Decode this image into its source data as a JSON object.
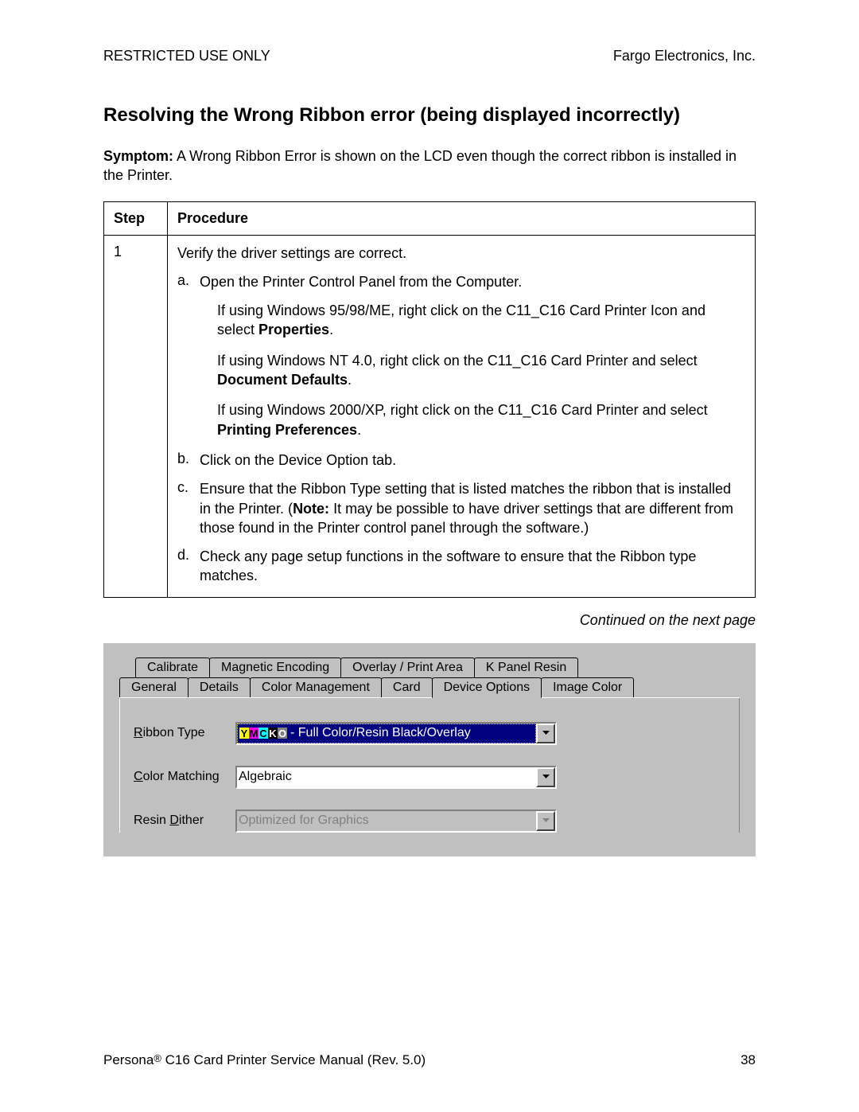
{
  "header": {
    "left": "RESTRICTED USE ONLY",
    "right": "Fargo Electronics, Inc."
  },
  "title": "Resolving the Wrong Ribbon error (being displayed incorrectly)",
  "symptom": {
    "label": "Symptom:",
    "text": "  A Wrong Ribbon Error is shown on the LCD even though the correct ribbon is installed in the Printer."
  },
  "table": {
    "headers": {
      "step": "Step",
      "procedure": "Procedure"
    },
    "step_num": "1",
    "verify_line": "Verify the driver settings are correct.",
    "items": {
      "a": {
        "letter": "a.",
        "text": "Open the Printer Control Panel from the Computer."
      },
      "a_sub1_pre": "If using Windows 95/98/ME, right click on the C11_C16 Card Printer Icon and select ",
      "a_sub1_bold": "Properties",
      "a_sub1_post": ".",
      "a_sub2_pre": "If using Windows NT 4.0, right click on the C11_C16 Card Printer and select ",
      "a_sub2_bold": "Document Defaults",
      "a_sub2_post": ".",
      "a_sub3_pre": "If using Windows 2000/XP, right click on the C11_C16 Card Printer and select ",
      "a_sub3_bold": "Printing Preferences",
      "a_sub3_post": ".",
      "b": {
        "letter": "b.",
        "text": "Click on the Device Option tab."
      },
      "c": {
        "letter": "c.",
        "pre": "Ensure that the Ribbon Type setting that is listed matches the ribbon that is installed in the Printer. (",
        "bold": "Note:",
        "post": "  It may be possible to have driver settings that are different from those found in the Printer control panel through the software.)"
      },
      "d": {
        "letter": "d.",
        "text": "Check any page setup functions in the software to ensure that the Ribbon type matches."
      }
    }
  },
  "continued": "Continued on the next page",
  "dialog": {
    "tabs_row1": [
      "Calibrate",
      "Magnetic Encoding",
      "Overlay / Print Area",
      "K Panel Resin"
    ],
    "tabs_row2": [
      "General",
      "Details",
      "Color Management",
      "Card",
      "Device Options",
      "Image Color"
    ],
    "active_tab": "Device Options",
    "fields": {
      "ribbon_type": {
        "label_pre": "R",
        "label_post": "ibbon Type",
        "value_suffix": " - Full Color/Resin Black/Overlay"
      },
      "color_matching": {
        "label_pre": "C",
        "label_post": "olor Matching",
        "value": "Algebraic"
      },
      "resin_dither": {
        "label_pre": "Resin ",
        "label_underline": "D",
        "label_post": "ither",
        "value": "Optimized for Graphics"
      }
    }
  },
  "footer": {
    "left_pre": "Persona",
    "left_reg": "®",
    "left_post": " C16 Card Printer Service Manual (Rev. 5.0)",
    "page_num": "38"
  }
}
